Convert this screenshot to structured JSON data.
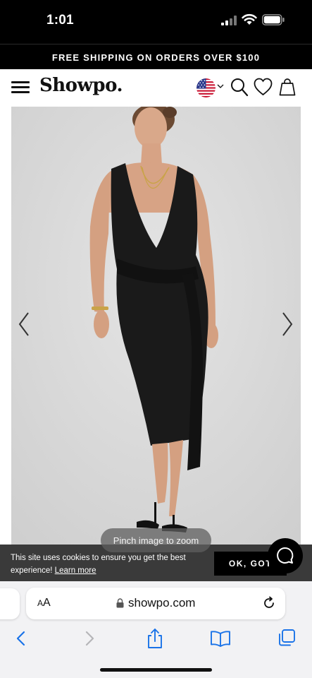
{
  "status_bar": {
    "time": "1:01"
  },
  "promo": {
    "text": "FREE SHIPPING ON ORDERS OVER $100"
  },
  "header": {
    "logo": "Showpo."
  },
  "product": {
    "zoom_hint": "Pinch image to zoom"
  },
  "cookie": {
    "message": "This site uses cookies to ensure you get the best experience!",
    "learn_more": "Learn more",
    "ok_label": "OK, GOT"
  },
  "browser": {
    "text_size_label": "AA",
    "url": "showpo.com"
  },
  "colors": {
    "dark": "#000000",
    "banner": "#3a3a3a",
    "link": "#1a73e8",
    "product_bg": "#dedede"
  },
  "icons": [
    "menu-icon",
    "us-flag-icon",
    "search-icon",
    "heart-icon",
    "bag-icon",
    "chevron-left-icon",
    "chevron-right-icon",
    "chat-icon",
    "lock-icon",
    "reload-icon",
    "share-icon",
    "bookmarks-icon",
    "tabs-icon"
  ]
}
